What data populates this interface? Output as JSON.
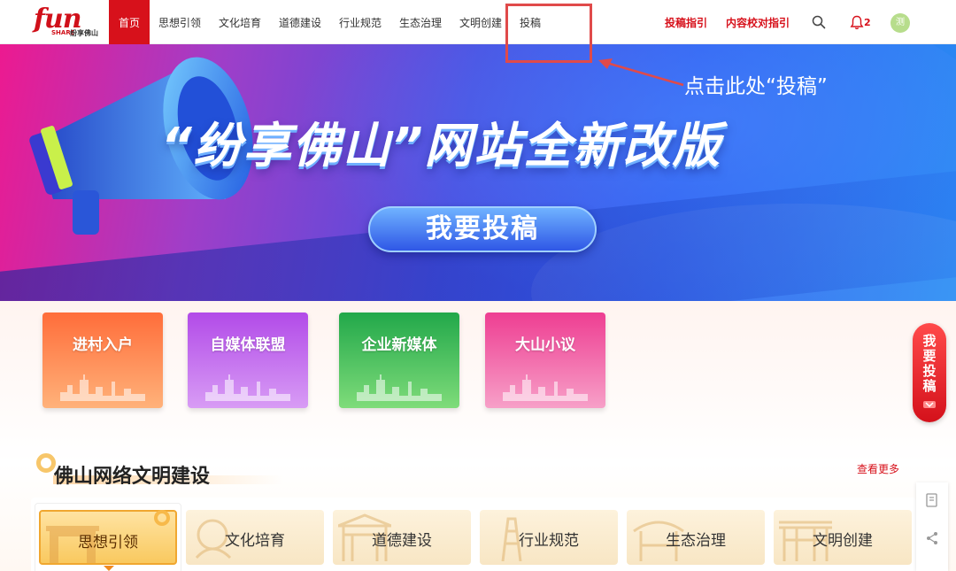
{
  "nav": {
    "logo_text": "fun",
    "logo_share": "SHARE",
    "logo_sub": "纷享佛山",
    "items": [
      {
        "label": "首页",
        "active": true
      },
      {
        "label": "思想引领"
      },
      {
        "label": "文化培育"
      },
      {
        "label": "道德建设"
      },
      {
        "label": "行业规范"
      },
      {
        "label": "生态治理"
      },
      {
        "label": "文明创建"
      },
      {
        "label": "投稿"
      }
    ],
    "guide_submit": "投稿指引",
    "guide_proofread": "内容校对指引",
    "search_icon": "search-icon",
    "bell_icon": "bell-icon",
    "notification_count": "2",
    "avatar_text": "测"
  },
  "annotation": {
    "text": "点击此处“投稿”",
    "color": "#e04a4a"
  },
  "banner": {
    "title": "“纷享佛山”网站全新改版",
    "button": "我要投稿"
  },
  "cards": [
    {
      "label": "进村入户"
    },
    {
      "label": "自媒体联盟"
    },
    {
      "label": "企业新媒体"
    },
    {
      "label": "大山小议"
    }
  ],
  "side_submit": {
    "text": "我要投稿"
  },
  "section": {
    "title": "佛山网络文明建设",
    "more": "查看更多",
    "tabs": [
      {
        "label": "思想引领",
        "active": true
      },
      {
        "label": "文化培育"
      },
      {
        "label": "道德建设"
      },
      {
        "label": "行业规范"
      },
      {
        "label": "生态治理"
      },
      {
        "label": "文明创建"
      }
    ]
  },
  "colors": {
    "brand_red": "#d7111b",
    "accent_gold": "#f7b94a"
  }
}
